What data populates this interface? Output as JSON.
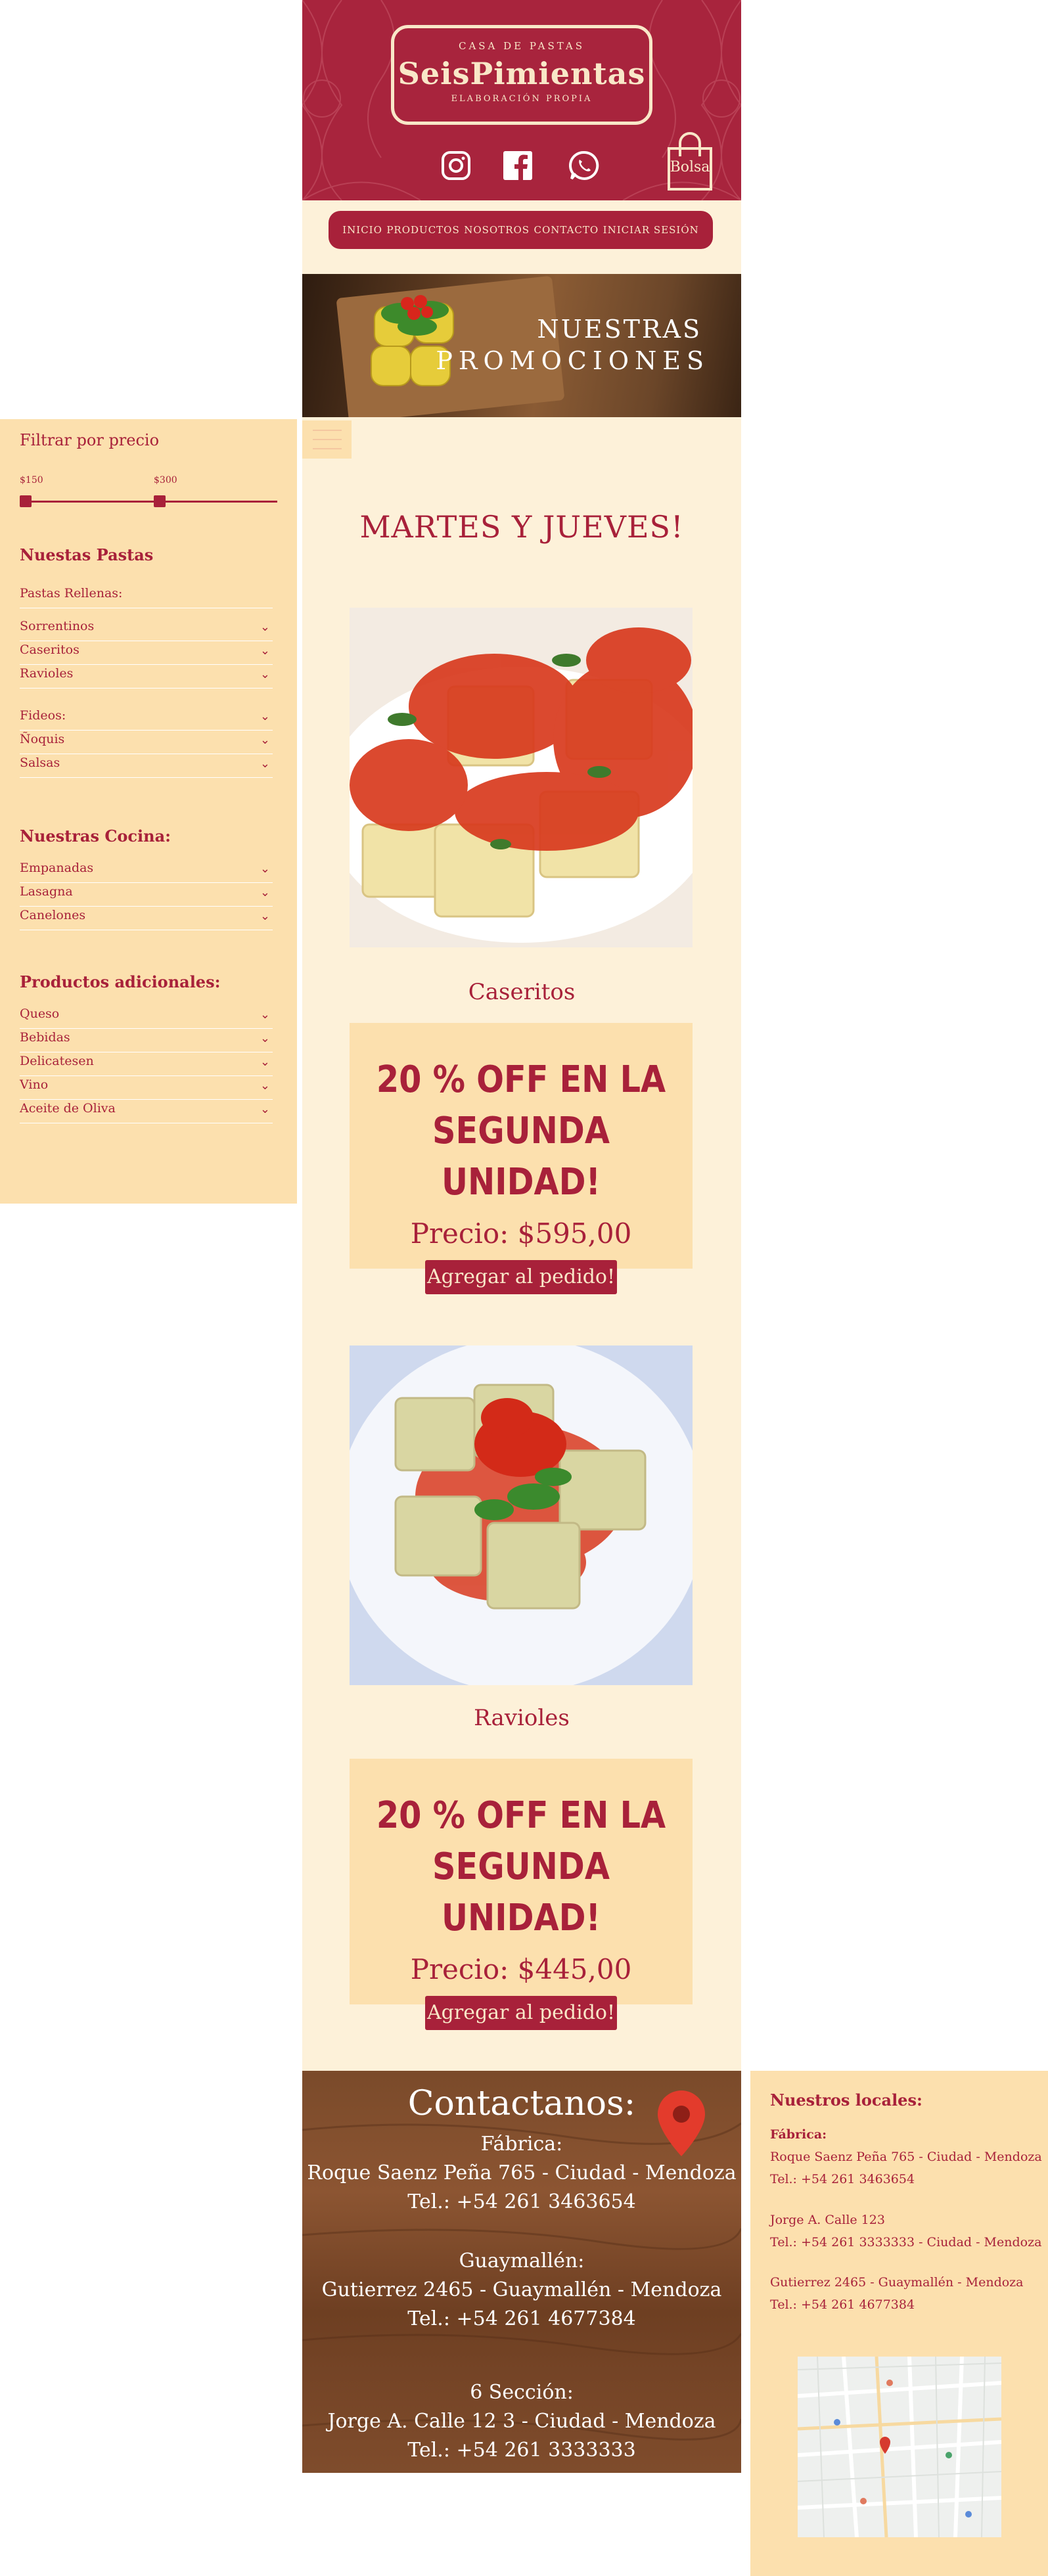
{
  "header": {
    "logo_top": "CASA DE PASTAS",
    "logo_name": "SeisPimientas",
    "logo_sub": "ELABORACIÓN PROPIA",
    "bag_label": "Bolsa"
  },
  "nav": {
    "items": [
      "INICIO",
      "PRODUCTOS",
      "NOSOTROS",
      "CONTACTO",
      "INICIAR SESIÓN"
    ]
  },
  "banner": {
    "line1": "NUESTRAS",
    "line2": "PROMOCIONES"
  },
  "promo": {
    "title": "MARTES Y JUEVES!",
    "products": [
      {
        "name": "Caseritos",
        "headline_1": "20 % OFF EN LA",
        "headline_2": "SEGUNDA UNIDAD!",
        "price": "Precio: $595,00",
        "button": "Agregar al pedido!"
      },
      {
        "name": "Ravioles",
        "headline_1": "20 % OFF EN LA",
        "headline_2": "SEGUNDA UNIDAD!",
        "price": "Precio: $445,00",
        "button": "Agregar al pedido!"
      }
    ]
  },
  "sidebar": {
    "filter_title": "Filtrar por precio",
    "price_min": "$150",
    "price_max": "$300",
    "pastas_title": "Nuestas Pastas",
    "rellenas_title": "Pastas Rellenas:",
    "rellenas": [
      "Sorrentinos",
      "Caseritos",
      "Ravioles"
    ],
    "otras": [
      "Fideos:",
      "Ñoquis",
      "Salsas"
    ],
    "cocina_title": "Nuestras Cocina:",
    "cocina": [
      "Empanadas",
      "Lasagna",
      "Canelones"
    ],
    "adicionales_title": "Productos adicionales:",
    "adicionales": [
      "Queso",
      "Bebidas",
      "Delicatesen",
      "Vino",
      "Aceite de Oliva"
    ],
    "chevron": "⌄"
  },
  "contact": {
    "title": "Contactanos:",
    "fabrica_label": "Fábrica:",
    "fabrica_address": "Roque Saenz Peña 765 - Ciudad - Mendoza",
    "fabrica_phone": "Tel.: +54 261 3463654",
    "guaymallen_label": "Guaymallén:",
    "guaymallen_address": "Gutierrez 2465 - Guaymallén - Mendoza",
    "guaymallen_phone": "Tel.: +54 261 4677384",
    "seccion_label": "6 Sección:",
    "seccion_address": "Jorge A. Calle 12 3 - Ciudad - Mendoza",
    "seccion_phone": "Tel.: +54 261 3333333"
  },
  "locations": {
    "title": "Nuestros locales:",
    "fabrica_label": "Fábrica:",
    "fabrica_address": "Roque Saenz Peña 765 - Ciudad - Mendoza",
    "fabrica_phone": "Tel.: +54 261 3463654",
    "loc2_address": "Jorge A. Calle 123",
    "loc2_phone": "Tel.: +54 261 3333333 - Ciudad - Mendoza",
    "loc3_address": "Gutierrez 2465 - Guaymallén - Mendoza",
    "loc3_phone": "Tel.: +54 261 4677384"
  },
  "colors": {
    "brand_red": "#a8213a",
    "cream": "#fdf1d9",
    "panel": "#fce0ae"
  }
}
